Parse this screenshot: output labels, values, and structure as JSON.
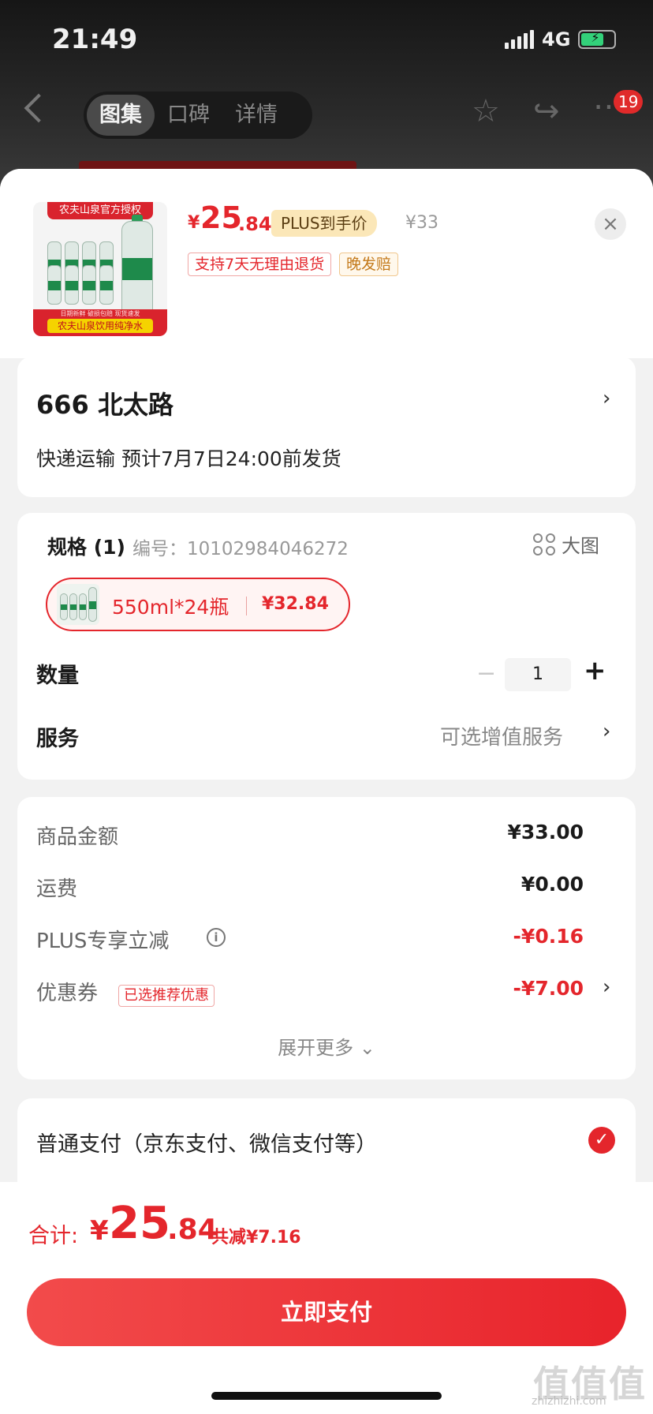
{
  "status_bar": {
    "time": "21:49",
    "network": "4G"
  },
  "nav": {
    "tabs": [
      {
        "label": "图集",
        "active": true
      },
      {
        "label": "口碑",
        "active": false
      },
      {
        "label": "详情",
        "active": false
      }
    ],
    "more_badge": "19"
  },
  "product": {
    "thumb_top_text": "农夫山泉官方授权",
    "thumb_bottom_line1": "日期新鲜 破损包赔 现货速发",
    "thumb_bottom_line2": "农夫山泉饮用纯净水",
    "price_symbol": "¥",
    "price_int": "25",
    "price_dec": ".84",
    "plus_tag": "PLUS到手价",
    "original_price": "¥33",
    "tags": [
      "支持7天无理由退货",
      "晚发赔"
    ],
    "close_symbol": "×"
  },
  "address": {
    "title": "666  北太路",
    "shipping": "快递运输 预计7月7日24:00前发货"
  },
  "spec": {
    "heading": "规格 (1)",
    "code": "编号：10102984046272",
    "big_image_label": "大图",
    "option_text": "550ml*24瓶",
    "option_price": "¥32.84",
    "quantity_label": "数量",
    "quantity_minus": "−",
    "quantity_value": "1",
    "quantity_plus": "+",
    "service_label": "服务",
    "service_value": "可选增值服务"
  },
  "fees": {
    "goods_label": "商品金额",
    "goods_value": "¥33.00",
    "shipping_label": "运费",
    "shipping_value": "¥0.00",
    "plus_label": "PLUS专享立减",
    "plus_value": "-¥0.16",
    "coupon_label": "优惠券",
    "coupon_tag": "已选推荐优惠",
    "coupon_value": "-¥7.00",
    "expand_label": "展开更多",
    "expand_icon": "⌄"
  },
  "payment": {
    "method_label": "普通支付（京东支付、微信支付等）",
    "check_symbol": "✓"
  },
  "footer": {
    "total_label": "合计:",
    "total_yen": "¥",
    "total_int": "25",
    "total_dec": ".84",
    "total_saving": "共减¥7.16",
    "pay_button": "立即支付"
  },
  "watermark": {
    "main": "值值值",
    "sub": "zhizhizhi.com"
  },
  "colors": {
    "accent": "#e4262c",
    "plus_gold": "#fbe7b8",
    "success": "#33d17a"
  }
}
